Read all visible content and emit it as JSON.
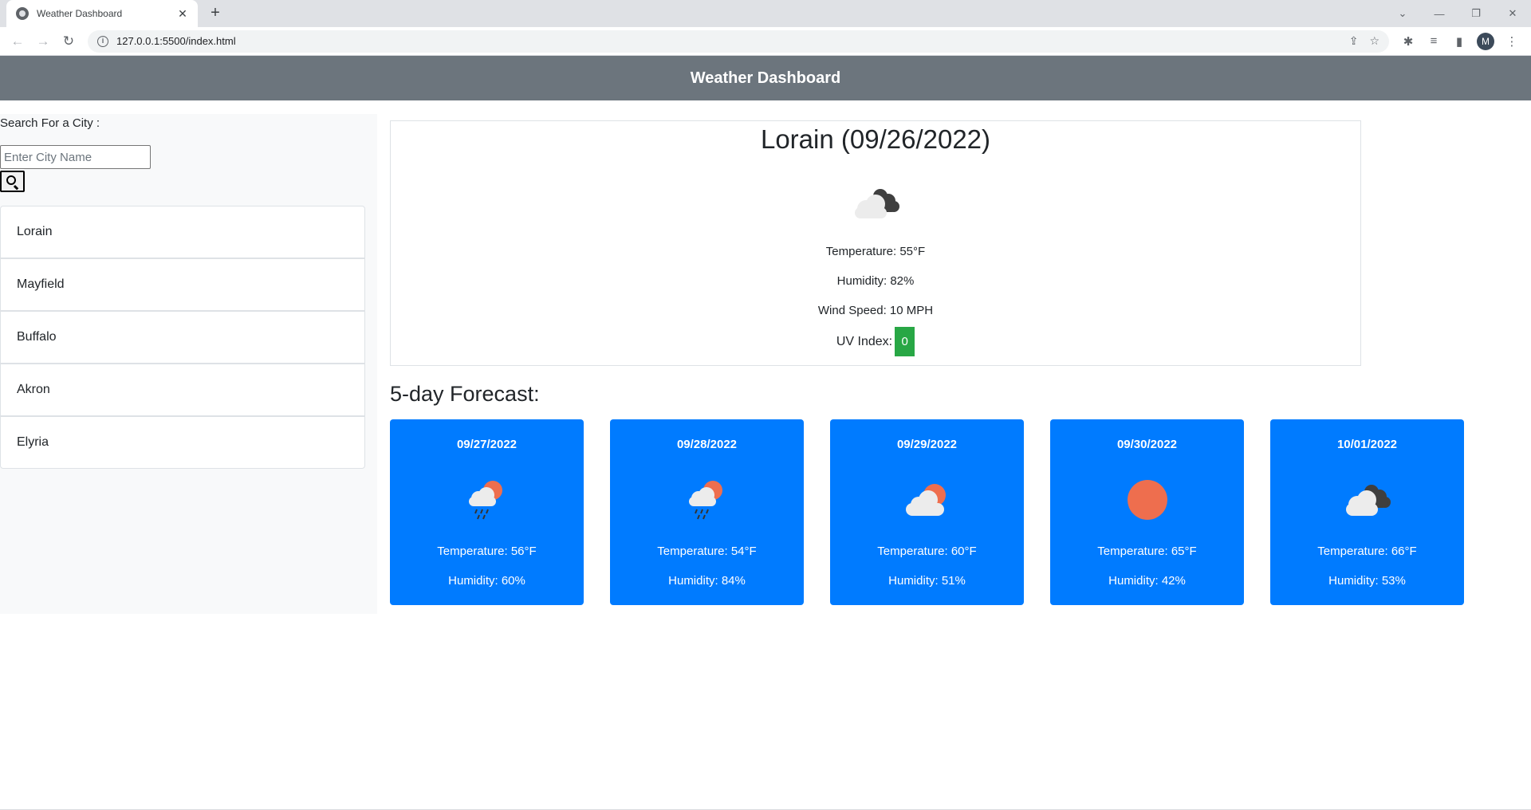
{
  "browser": {
    "tab_title": "Weather Dashboard",
    "tab_close": "✕",
    "new_tab": "+",
    "url": "127.0.0.1:5500/index.html",
    "profile_initial": "M"
  },
  "header": {
    "title": "Weather Dashboard"
  },
  "sidebar": {
    "search_label": "Search For a City :",
    "search_placeholder": "Enter City Name",
    "cities": [
      "Lorain",
      "Mayfield",
      "Buffalo",
      "Akron",
      "Elyria"
    ]
  },
  "current": {
    "title": "Lorain (09/26/2022)",
    "icon": "overcast-clouds-icon",
    "temperature": "Temperature: 55°F",
    "humidity": "Humidity: 82%",
    "wind": "Wind Speed: 10 MPH",
    "uv_label": "UV Index:",
    "uv_value": "0",
    "uv_color": "#28a745"
  },
  "forecast": {
    "title": "5-day Forecast:",
    "card_color": "#007bff",
    "days": [
      {
        "date": "09/27/2022",
        "icon": "rain-sun-icon",
        "temperature": "Temperature: 56°F",
        "humidity": "Humidity: 60%"
      },
      {
        "date": "09/28/2022",
        "icon": "rain-sun-icon",
        "temperature": "Temperature: 54°F",
        "humidity": "Humidity: 84%"
      },
      {
        "date": "09/29/2022",
        "icon": "cloud-sun-icon",
        "temperature": "Temperature: 60°F",
        "humidity": "Humidity: 51%"
      },
      {
        "date": "09/30/2022",
        "icon": "sun-icon",
        "temperature": "Temperature: 65°F",
        "humidity": "Humidity: 42%"
      },
      {
        "date": "10/01/2022",
        "icon": "overcast-clouds-icon",
        "temperature": "Temperature: 66°F",
        "humidity": "Humidity: 53%"
      }
    ]
  }
}
